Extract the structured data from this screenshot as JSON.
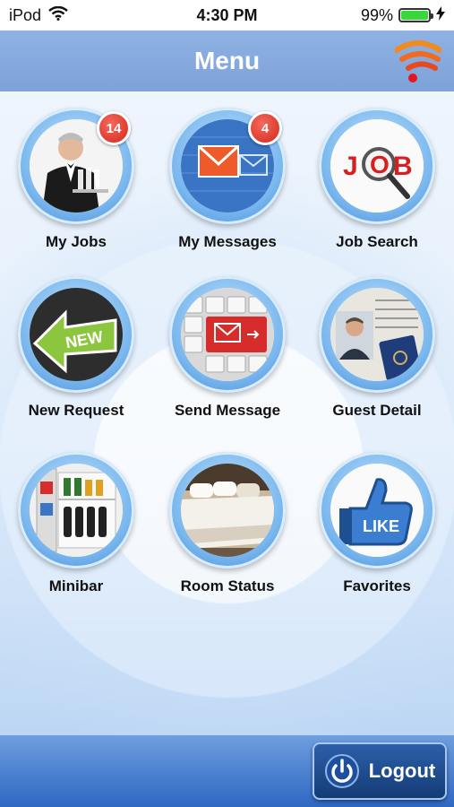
{
  "status_bar": {
    "device": "iPod",
    "time": "4:30 PM",
    "battery": "99%",
    "battery_level": 0.99,
    "icons": [
      "wifi-icon",
      "battery-icon",
      "charging-bolt-icon"
    ]
  },
  "header": {
    "title": "Menu",
    "logo_icon": "rss-wifi-icon"
  },
  "menu": {
    "items": [
      {
        "label": "My Jobs",
        "badge": "14",
        "icon": "waiter-icon"
      },
      {
        "label": "My Messages",
        "badge": "4",
        "icon": "envelope-icon"
      },
      {
        "label": "Job Search",
        "icon": "job-search-icon"
      },
      {
        "label": "New Request",
        "icon": "new-arrow-icon"
      },
      {
        "label": "Send Message",
        "icon": "keyboard-mail-icon"
      },
      {
        "label": "Guest Detail",
        "icon": "passport-icon"
      },
      {
        "label": "Minibar",
        "icon": "fridge-icon"
      },
      {
        "label": "Room Status",
        "icon": "bed-icon"
      },
      {
        "label": "Favorites",
        "icon": "like-thumb-icon"
      }
    ]
  },
  "footer": {
    "logout_label": "Logout",
    "logout_icon": "power-icon"
  },
  "colors": {
    "header": "#8fb2e3",
    "badge": "#d6261b",
    "ring": "#79b7ee",
    "logout": "#143c77",
    "battery": "#39d63c"
  }
}
